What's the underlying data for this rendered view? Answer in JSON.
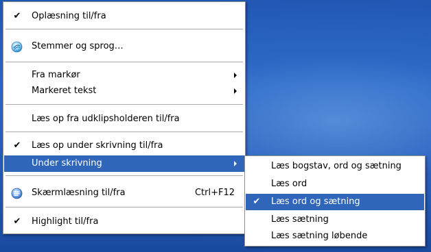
{
  "main_menu": {
    "items": [
      {
        "label": "Oplæsning til/fra",
        "checked": true
      },
      {
        "label": "Stemmer og sprog…",
        "icon": "voice-settings-icon"
      },
      {
        "label": "Fra markør",
        "submenu": true
      },
      {
        "label": "Markeret tekst",
        "submenu": true
      },
      {
        "label": "Læs op fra udklipsholderen til/fra"
      },
      {
        "label": "Læs op under skrivning til/fra",
        "checked": true
      },
      {
        "label": "Under skrivning",
        "submenu": true,
        "selected": true
      },
      {
        "label": "Skærmlæsning til/fra",
        "icon": "screen-reader-icon",
        "shortcut": "Ctrl+F12"
      },
      {
        "label": "Highlight til/fra",
        "checked": true
      }
    ]
  },
  "sub_menu": {
    "items": [
      {
        "label": "Læs bogstav, ord og sætning"
      },
      {
        "label": "Læs ord"
      },
      {
        "label": "Læs ord og sætning",
        "checked": true,
        "selected": true
      },
      {
        "label": "Læs sætning"
      },
      {
        "label": "Læs sætning løbende"
      }
    ]
  },
  "glyphs": {
    "check": "✔"
  },
  "colors": {
    "selection": "#2f66b9",
    "desktop": "#2a66c6"
  }
}
